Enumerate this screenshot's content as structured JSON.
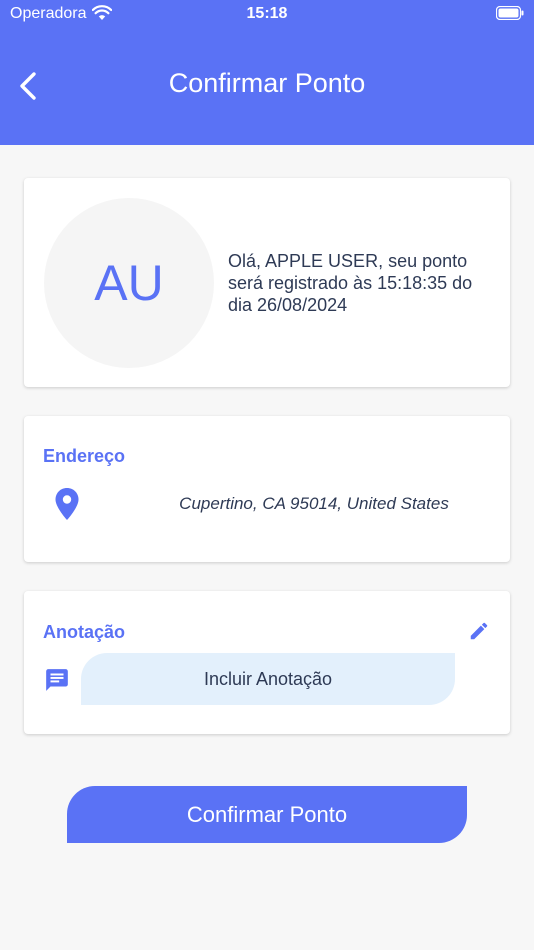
{
  "status_bar": {
    "carrier": "Operadora",
    "time": "15:18"
  },
  "header": {
    "title": "Confirmar Ponto",
    "back_icon": "chevron-left-icon"
  },
  "greeting_card": {
    "avatar_initials": "AU",
    "message": "Olá, APPLE USER, seu ponto será registrado às 15:18:35 do dia 26/08/2024"
  },
  "address_card": {
    "title": "Endereço",
    "icon": "location-pin-icon",
    "address": "Cupertino, CA 95014, United States"
  },
  "note_card": {
    "title": "Anotação",
    "edit_icon": "pencil-icon",
    "chat_icon": "chat-bubble-icon",
    "button_label": "Incluir Anotação"
  },
  "confirm_button": {
    "label": "Confirmar Ponto"
  },
  "colors": {
    "primary": "#5a72f5",
    "note_button_bg": "#e3f0fc",
    "text_dark": "#2e3a55",
    "background": "#f7f7f7"
  }
}
